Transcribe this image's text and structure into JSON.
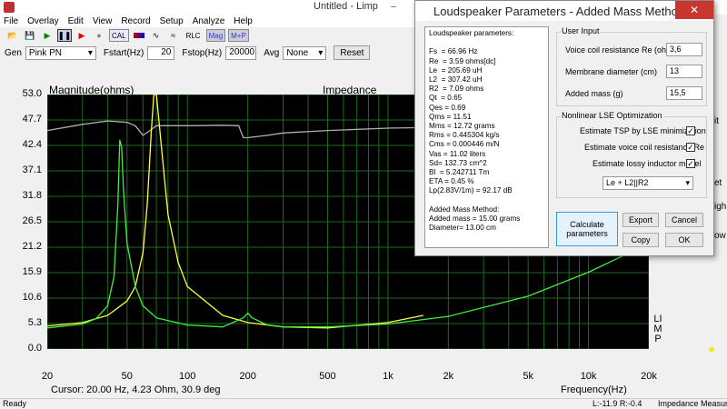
{
  "app": {
    "title": "Untitled - Limp",
    "window_controls": [
      "–",
      "☐",
      "✕"
    ]
  },
  "menu": [
    "File",
    "Overlay",
    "Edit",
    "View",
    "Record",
    "Setup",
    "Analyze",
    "Help"
  ],
  "toolbar": {
    "cal": "CAL",
    "rlc": "RLC",
    "mag": "Mag",
    "mp": "M+P"
  },
  "genbar": {
    "gen_label": "Gen",
    "gen_value": "Pink PN",
    "fstart_label": "Fstart(Hz)",
    "fstart_value": "20",
    "fstop_label": "Fstop(Hz)",
    "fstop_value": "20000",
    "avg_label": "Avg",
    "avg_value": "None",
    "reset": "Reset"
  },
  "chart_data": {
    "type": "line",
    "title": "Impedance",
    "ylabel": "Magnitude(ohms)",
    "xlabel": "Frequency(Hz)",
    "x_scale": "log",
    "xlim": [
      20,
      20000
    ],
    "ylim": [
      0,
      53
    ],
    "yticks": [
      "53.0",
      "47.7",
      "42.4",
      "37.1",
      "31.8",
      "26.5",
      "21.2",
      "15.9",
      "10.6",
      "5.3",
      "0.0"
    ],
    "xticks": [
      "20",
      "50",
      "100",
      "200",
      "500",
      "1k",
      "2k",
      "5k",
      "10k",
      "20k"
    ],
    "grid": true,
    "right_label": "LIMP",
    "series": [
      {
        "color": "#b0b0b0",
        "x": [
          20,
          30,
          40,
          50,
          55,
          60,
          65,
          70,
          100,
          150,
          180,
          190,
          200,
          250,
          300,
          500,
          1000,
          2000,
          5000,
          10000,
          20000
        ],
        "y": [
          45.5,
          46.8,
          47.5,
          47.2,
          46.5,
          44.5,
          45.5,
          46.5,
          46.5,
          46.6,
          46.5,
          44,
          44,
          44.5,
          45,
          45.5,
          46,
          46.2,
          47,
          47.7,
          48
        ]
      },
      {
        "color": "#ffff40",
        "x": [
          20,
          30,
          40,
          50,
          55,
          60,
          63,
          66,
          68,
          70,
          75,
          80,
          90,
          100,
          150,
          200,
          300,
          500,
          1000,
          1500
        ],
        "y": [
          4.8,
          5.5,
          7,
          10,
          13,
          20,
          30,
          45,
          53,
          53,
          40,
          28,
          18,
          13,
          7,
          5.5,
          4.6,
          4.4,
          5.5,
          7
        ]
      },
      {
        "color": "#40f040",
        "x": [
          20,
          30,
          35,
          40,
          43,
          45,
          46,
          47,
          48,
          50,
          55,
          60,
          70,
          100,
          150,
          190,
          200,
          210,
          250,
          300,
          500,
          1000,
          2000,
          5000,
          10000,
          20000
        ],
        "y": [
          4.4,
          5.2,
          6.3,
          9,
          15,
          30,
          43.5,
          42,
          33,
          22,
          13,
          9,
          6.5,
          5,
          4.6,
          6.5,
          7.5,
          6.5,
          5,
          4.6,
          4.6,
          5.2,
          6.8,
          11,
          16,
          22
        ]
      }
    ]
  },
  "cursor_text": "Cursor: 20.00 Hz, 4.23 Ohm, 30.9 deg",
  "status": {
    "left": "Ready",
    "lr": "L:-11.9 R:-0.4",
    "mode": "Impedance Measure"
  },
  "dialog": {
    "title": "Loudspeaker Parameters - Added Mass Method",
    "results": "Loudspeaker parameters:\n\nFs  = 66.96 Hz\nRe  = 3.59 ohms[dc]\nLe  = 205.69 uH\nL2  = 307.42 uH\nR2  = 7.09 ohms\nQt  = 0.65\nQes = 0.69\nQms = 11.51\nMms = 12.72 grams\nRms = 0.445304 kg/s\nCms = 0.000446 m/N\nVas = 11.02 liters\nSd= 132.73 cm^2\nBl  = 5.242711 Tm\nETA = 0.45 %\nLp(2.83V/1m) = 92.17 dB\n\nAdded Mass Method:\nAdded mass = 15.00 grams\nDiameter= 13.00 cm",
    "user_input_label": "User Input",
    "re_label": "Voice coil resistance Re (ohms)",
    "re_value": "3,6",
    "diam_label": "Membrane diameter (cm)",
    "diam_value": "13",
    "mass_label": "Added mass (g)",
    "mass_value": "15,5",
    "lse_label": "Nonlinear LSE Optimization",
    "chk1": "Estimate TSP by LSE minimization",
    "chk2": "Estimate voice coil resistance Re",
    "chk3": "Estimate lossy inductor model",
    "model_value": "Le + L2||R2",
    "calc": "Calculate parameters",
    "export": "Export",
    "cancel": "Cancel",
    "copy": "Copy",
    "ok": "OK"
  },
  "side_partial": [
    "it",
    "et",
    "igh",
    "ow"
  ]
}
